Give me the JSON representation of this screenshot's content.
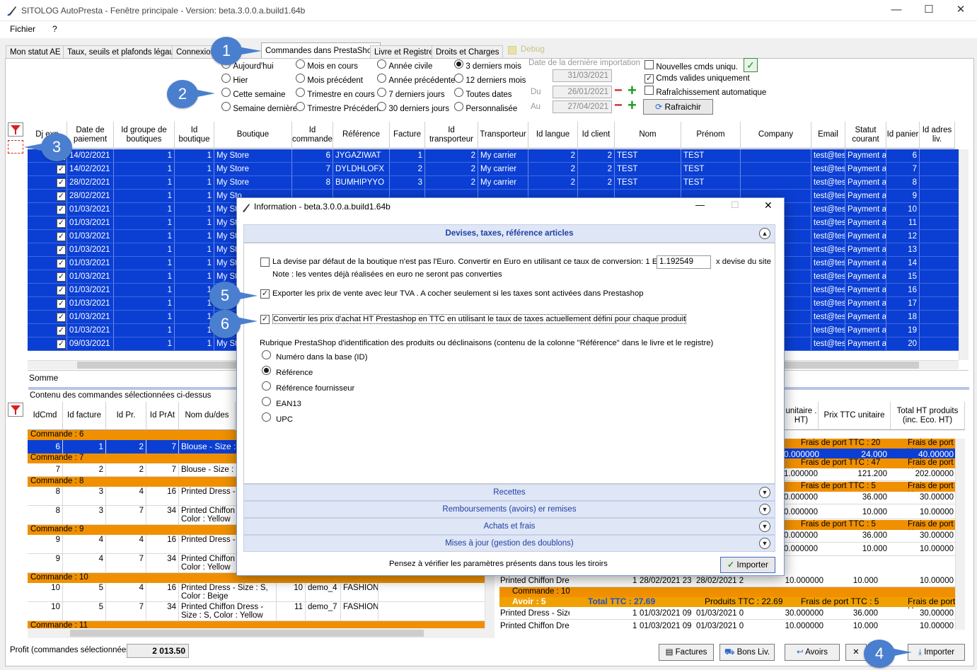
{
  "window": {
    "title": "SITOLOG AutoPresta - Fenêtre principale - Version: beta.3.0.0.a.build1.64b",
    "min": "—",
    "max": "☐",
    "close": "✕"
  },
  "menu": [
    "Fichier",
    "?"
  ],
  "tabs": [
    "Mon statut AE",
    "Taux, seuils et plafonds légaux",
    "Connexion à",
    "Commandes dans PrestaShop",
    "Livre et Registre",
    "Droits et Charges"
  ],
  "debug_label": "Debug",
  "periods": {
    "col1": [
      "Aujourd'hui",
      "Hier",
      "Cette semaine",
      "Semaine dernière"
    ],
    "col2": [
      "Mois en cours",
      "Mois précédent",
      "Trimestre en cours",
      "Trimestre Précédent"
    ],
    "col3": [
      "Année civile",
      "Année précédente",
      "7 derniers jours",
      "30 derniers jours"
    ],
    "col4": [
      "3 derniers mois",
      "12 derniers mois",
      "Toutes dates",
      "Personnalisée"
    ],
    "selected": "3 derniers mois"
  },
  "last_import": {
    "label": "Date de la dernière importation",
    "value": "31/03/2021"
  },
  "du": {
    "label": "Du",
    "value": "26/01/2021"
  },
  "au": {
    "label": "Au",
    "value": "27/04/2021"
  },
  "options": {
    "nouvelles": "Nouvelles cmds uniqu.",
    "valides": "Cmds valides uniquement",
    "auto": "Rafraîchissement automatique"
  },
  "refresh_label": "Rafraichir",
  "grid": {
    "headers": [
      "Dj exp",
      "Date de paiement",
      "Id groupe de boutiques",
      "Id boutique",
      "Boutique",
      "Id commande",
      "Référence",
      "Facture",
      "Id transporteur",
      "Transporteur",
      "Id langue",
      "Id client",
      "Nom",
      "Prénom",
      "Company",
      "Email",
      "Statut courant",
      "Id panier",
      "Id adres liv."
    ],
    "rows": [
      [
        "14/02/2021",
        "1",
        "1",
        "My Store",
        "6",
        "JYGAZIWAT",
        "1",
        "2",
        "My carrier",
        "2",
        "2",
        "TEST",
        "TEST",
        "",
        "test@test",
        "Payment acc",
        "6"
      ],
      [
        "14/02/2021",
        "1",
        "1",
        "My Store",
        "7",
        "DYLDHLOFX",
        "2",
        "2",
        "My carrier",
        "2",
        "2",
        "TEST",
        "TEST",
        "",
        "test@test",
        "Payment acc",
        "7"
      ],
      [
        "28/02/2021",
        "1",
        "1",
        "My Store",
        "8",
        "BUMHIPYYO",
        "3",
        "2",
        "My carrier",
        "2",
        "2",
        "TEST",
        "TEST",
        "",
        "test@test",
        "Payment acc",
        "8"
      ],
      [
        "28/02/2021",
        "1",
        "1",
        "My Sto",
        "",
        "",
        "",
        "",
        "",
        "",
        "",
        "",
        "",
        "",
        "test@test",
        "Payment acc",
        "9"
      ],
      [
        "01/03/2021",
        "1",
        "1",
        "My Sto",
        "",
        "",
        "",
        "",
        "",
        "",
        "",
        "",
        "",
        "",
        "test@test",
        "Payment acc",
        "10"
      ],
      [
        "01/03/2021",
        "1",
        "1",
        "My Sto",
        "",
        "",
        "",
        "",
        "",
        "",
        "",
        "",
        "",
        "",
        "test@test",
        "Payment acc",
        "11"
      ],
      [
        "01/03/2021",
        "1",
        "1",
        "My Sto",
        "",
        "",
        "",
        "",
        "",
        "",
        "",
        "",
        "",
        "",
        "test@test",
        "Payment acc",
        "12"
      ],
      [
        "01/03/2021",
        "1",
        "1",
        "My Sto",
        "",
        "",
        "",
        "",
        "",
        "",
        "",
        "",
        "",
        "",
        "test@test",
        "Payment acc",
        "13"
      ],
      [
        "01/03/2021",
        "1",
        "1",
        "My Sto",
        "",
        "",
        "",
        "",
        "",
        "",
        "",
        "",
        "",
        "",
        "test@test",
        "Payment acc",
        "14"
      ],
      [
        "01/03/2021",
        "1",
        "1",
        "My Sto",
        "",
        "",
        "",
        "",
        "",
        "",
        "",
        "",
        "",
        "",
        "test@test",
        "Payment acc",
        "15"
      ],
      [
        "01/03/2021",
        "1",
        "1",
        "My Sto",
        "",
        "",
        "",
        "",
        "",
        "",
        "",
        "",
        "",
        "",
        "test@test",
        "Payment acc",
        "16"
      ],
      [
        "01/03/2021",
        "1",
        "1",
        "My Sto",
        "",
        "",
        "",
        "",
        "",
        "",
        "",
        "",
        "",
        "",
        "test@test",
        "Payment acc",
        "17"
      ],
      [
        "01/03/2021",
        "1",
        "1",
        "My Sto",
        "",
        "",
        "",
        "",
        "",
        "",
        "",
        "",
        "",
        "",
        "test@test",
        "Payment acc",
        "18"
      ],
      [
        "01/03/2021",
        "1",
        "1",
        "My Sto",
        "",
        "",
        "",
        "",
        "",
        "",
        "",
        "",
        "",
        "",
        "test@test",
        "Payment acc",
        "19"
      ],
      [
        "09/03/2021",
        "1",
        "1",
        "My Sto",
        "",
        "",
        "",
        "",
        "",
        "",
        "",
        "",
        "",
        "",
        "test@test",
        "Payment acc",
        "20"
      ]
    ],
    "sum_label": "Somme"
  },
  "lower": {
    "title": "Contenu des commandes sélectionnées ci-dessus",
    "headers": [
      "IdCmd",
      "Id facture",
      "Id Pr.",
      "Id PrAt",
      "Nom du/des"
    ],
    "rows": [
      {
        "group": "Commande : 6"
      },
      {
        "cells": [
          "6",
          "1",
          "2",
          "7",
          "Blouse - Size : S"
        ],
        "sel": true
      },
      {
        "group": "Commande : 7"
      },
      {
        "cells": [
          "7",
          "2",
          "2",
          "7",
          "Blouse - Size : S"
        ]
      },
      {
        "group": "Commande : 8"
      },
      {
        "cells": [
          "8",
          "3",
          "4",
          "16",
          "Printed Dress - S Beige"
        ]
      },
      {
        "cells": [
          "8",
          "3",
          "7",
          "34",
          "Printed Chiffon D S, Color : Yellow"
        ]
      },
      {
        "group": "Commande : 9"
      },
      {
        "cells": [
          "9",
          "4",
          "4",
          "16",
          "Printed Dress - S Beige"
        ]
      },
      {
        "cells": [
          "9",
          "4",
          "7",
          "34",
          "Printed Chiffon D S, Color : Yellow"
        ]
      },
      {
        "group": "Commande : 10"
      },
      {
        "cells": [
          "10",
          "5",
          "4",
          "16",
          "Printed Dress - Size : S, Color : Beige",
          "10",
          "demo_4",
          "FASHION"
        ]
      },
      {
        "cells": [
          "10",
          "5",
          "7",
          "34",
          "Printed Chiffon Dress - Size : S, Color : Yellow",
          "11",
          "demo_7",
          "FASHION"
        ]
      },
      {
        "group": "Commande : 11"
      }
    ]
  },
  "right": {
    "headers": [
      "unitaire . HT)",
      "Prix TTC unitaire",
      "Total HT produits (inc. Eco. HT)"
    ],
    "rows": [
      {
        "t": "o",
        "a": "Frais de port TTC : 20",
        "b": "Frais de port H"
      },
      {
        "t": "s",
        "a": "0.000000",
        "b": "24.000",
        "c": "40.00000"
      },
      {
        "t": "o",
        "a": "Frais de port TTC : 47",
        "b": "Frais de port H"
      },
      {
        "t": "w",
        "a": "1.000000",
        "b": "121.200",
        "c": "202.00000"
      },
      {
        "t": "o",
        "a": "Frais de port TTC : 5",
        "b": "Frais de port H"
      },
      {
        "t": "w",
        "a": "0.000000",
        "b": "36.000",
        "c": "30.00000"
      },
      {
        "t": "w",
        "a": "0.000000",
        "b": "10.000",
        "c": "10.00000"
      },
      {
        "t": "o",
        "a": "Frais de port TTC : 5",
        "b": "Frais de port H"
      },
      {
        "t": "w",
        "a": "0.000000",
        "b": "36.000",
        "c": "30.00000"
      },
      {
        "t": "w",
        "a": "0.000000",
        "b": "10.000",
        "c": "10.00000"
      }
    ],
    "chiffon": [
      "Printed Chiffon Dress",
      "1",
      "28/02/2021 23",
      "28/02/2021 2",
      "10.000000",
      "10.000",
      "10.00000"
    ],
    "cmd10": "Commande : 10",
    "avoir": {
      "label": "Avoir : 5",
      "total": "Total TTC : 27.69",
      "produits": "Produits TTC : 22.69",
      "port": "Frais de port TTC : 5",
      "porth": "Frais de port H"
    },
    "r1": [
      "Printed Dress - Size",
      "1",
      "01/03/2021 09",
      "01/03/2021 0",
      "30.000000",
      "36.000",
      "30.00000"
    ],
    "r2": [
      "Printed Chiffon Dress",
      "1",
      "01/03/2021 09",
      "01/03/2021 0",
      "10.000000",
      "10.000",
      "10.00000"
    ]
  },
  "footer": {
    "profit_label": "Profit (commandes sélectionnées)",
    "profit_value": "2 013.50",
    "buttons": [
      "Factures",
      "Bons Liv.",
      "Avoirs",
      "Importer"
    ]
  },
  "dialog": {
    "title": "Information - beta.3.0.0.a.build1.64b",
    "section": "Devises, taxes, référence articles",
    "euro_text": "La devise par défaut de la boutique n'est pas l'Euro. Convertir en Euro en utilisant ce taux de conversion: 1 Euro =",
    "rate": "1.192549",
    "euro_suffix": "x devise du site",
    "note": "Note : les ventes déjà réalisées en euro ne seront pas converties",
    "export_tva": "Exporter les prix de vente avec leur TVA . A cocher seulement si les taxes sont activées dans Prestashop",
    "convert_ttc": "Convertir les prix d'achat HT Prestashop en TTC en utilisant le taux de taxes actuellement défini pour chaque produit",
    "rubrique": "Rubrique PrestaShop d'identification des produits ou déclinaisons (contenu de la colonne \"Référence\" dans le livre et le registre)",
    "ref_options": [
      "Numéro dans la base (ID)",
      "Référence",
      "Référence fournisseur",
      "EAN13",
      "UPC"
    ],
    "ref_selected": "Référence",
    "drawers": [
      "Recettes",
      "Remboursements (avoirs) er remises",
      "Achats et frais",
      "Mises à jour (gestion des doublons)"
    ],
    "hint": "Pensez à vérifier les paramètres présents dans tous les tiroirs",
    "import_label": "Importer"
  },
  "bubbles": [
    "1",
    "2",
    "3",
    "4",
    "5",
    "6"
  ],
  "colors": {
    "selection": "#0b3fd4",
    "group": "#f09000",
    "bubble": "#4a7fcf",
    "drawer": "#dfe6f5"
  }
}
